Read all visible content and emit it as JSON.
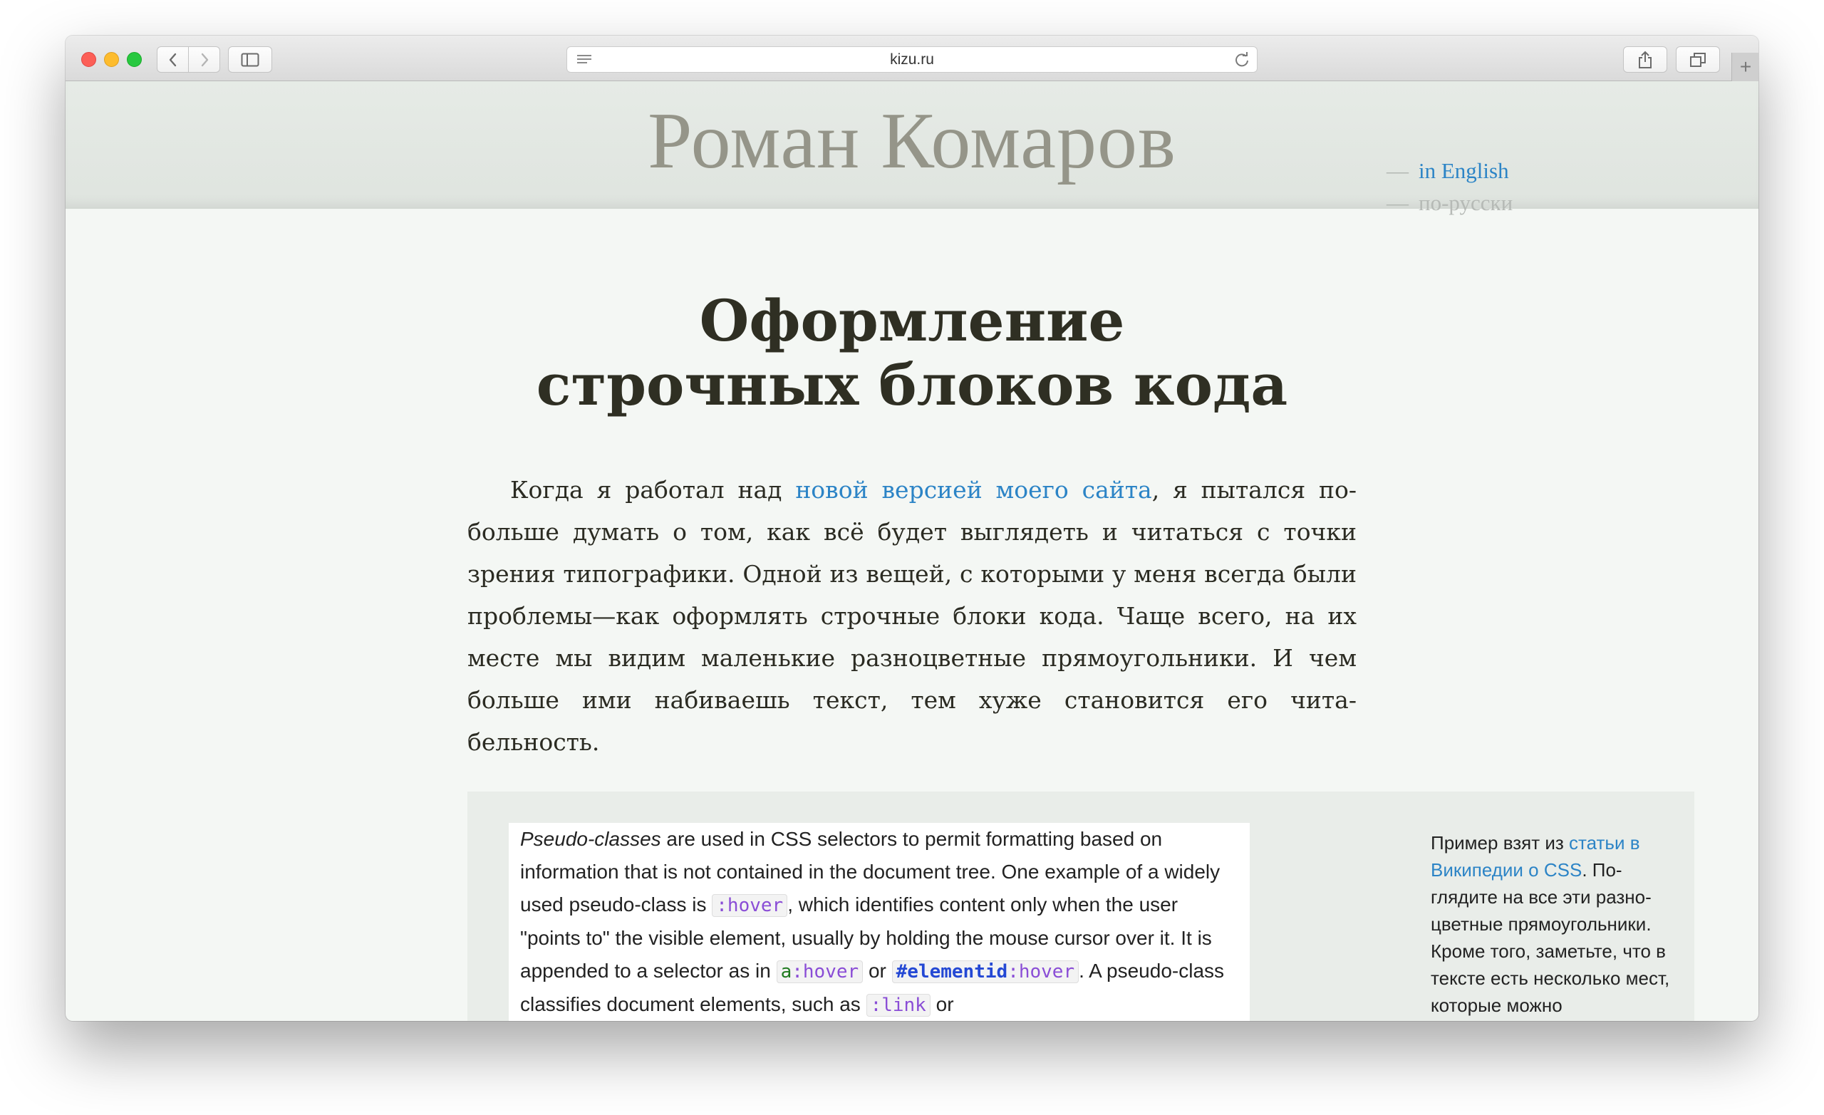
{
  "browser": {
    "url": "kizu.ru"
  },
  "header": {
    "site_name": "Роман Комаров",
    "lang_dash": "—",
    "lang_en": "in English",
    "lang_ru": "по-русски"
  },
  "article": {
    "title_line1": "Оформление",
    "title_line2": "строчных блоков кода",
    "para": {
      "before_link": "Когда я работал над ",
      "link": "новой версией моего сайта",
      "after_link": ", я пытался по-больше думать о том, как всё будет выглядеть и читаться с точки зрения типографики. Одной из вещей, с которыми у меня всегда были проблемы—как оформлять строчные блоки кода. Чаще всего, на их месте мы видим маленькие разноцветные прямоугольники. И чем больше ими набиваешь текст, тем хуже становится его чита-бельность."
    }
  },
  "example": {
    "em": "Pseudo-classes",
    "t1": " are used in CSS selectors to permit formatting based on information that is not contained in the document tree. One example of a widely used pseudo-class is ",
    "code_hover": ":hover",
    "t2": ", which identifies content only when the user \"points to\" the visible element, usually by holding the mouse cursor over it. It is appended to a selector as in ",
    "code_a": "a",
    "code_a_hover": ":hover",
    "t3": " or ",
    "code_elid": "#elementid",
    "code_elid_hover": ":hover",
    "t4": ". A pseudo-class classifies document elements, such as ",
    "code_link": ":link",
    "t5": " or"
  },
  "aside": {
    "before_link": "Пример взят из ",
    "link": "статьи в Википедии о CSS",
    "after_link": ". По-глядите на все эти разно-цветные прямоугольники. Кроме того, заметьте, что в тексте есть несколько мест, которые можно"
  },
  "colors": {
    "link": "#2c84c6",
    "page_bg": "#f4f7f4",
    "header_bg": "#e3e8e3"
  }
}
